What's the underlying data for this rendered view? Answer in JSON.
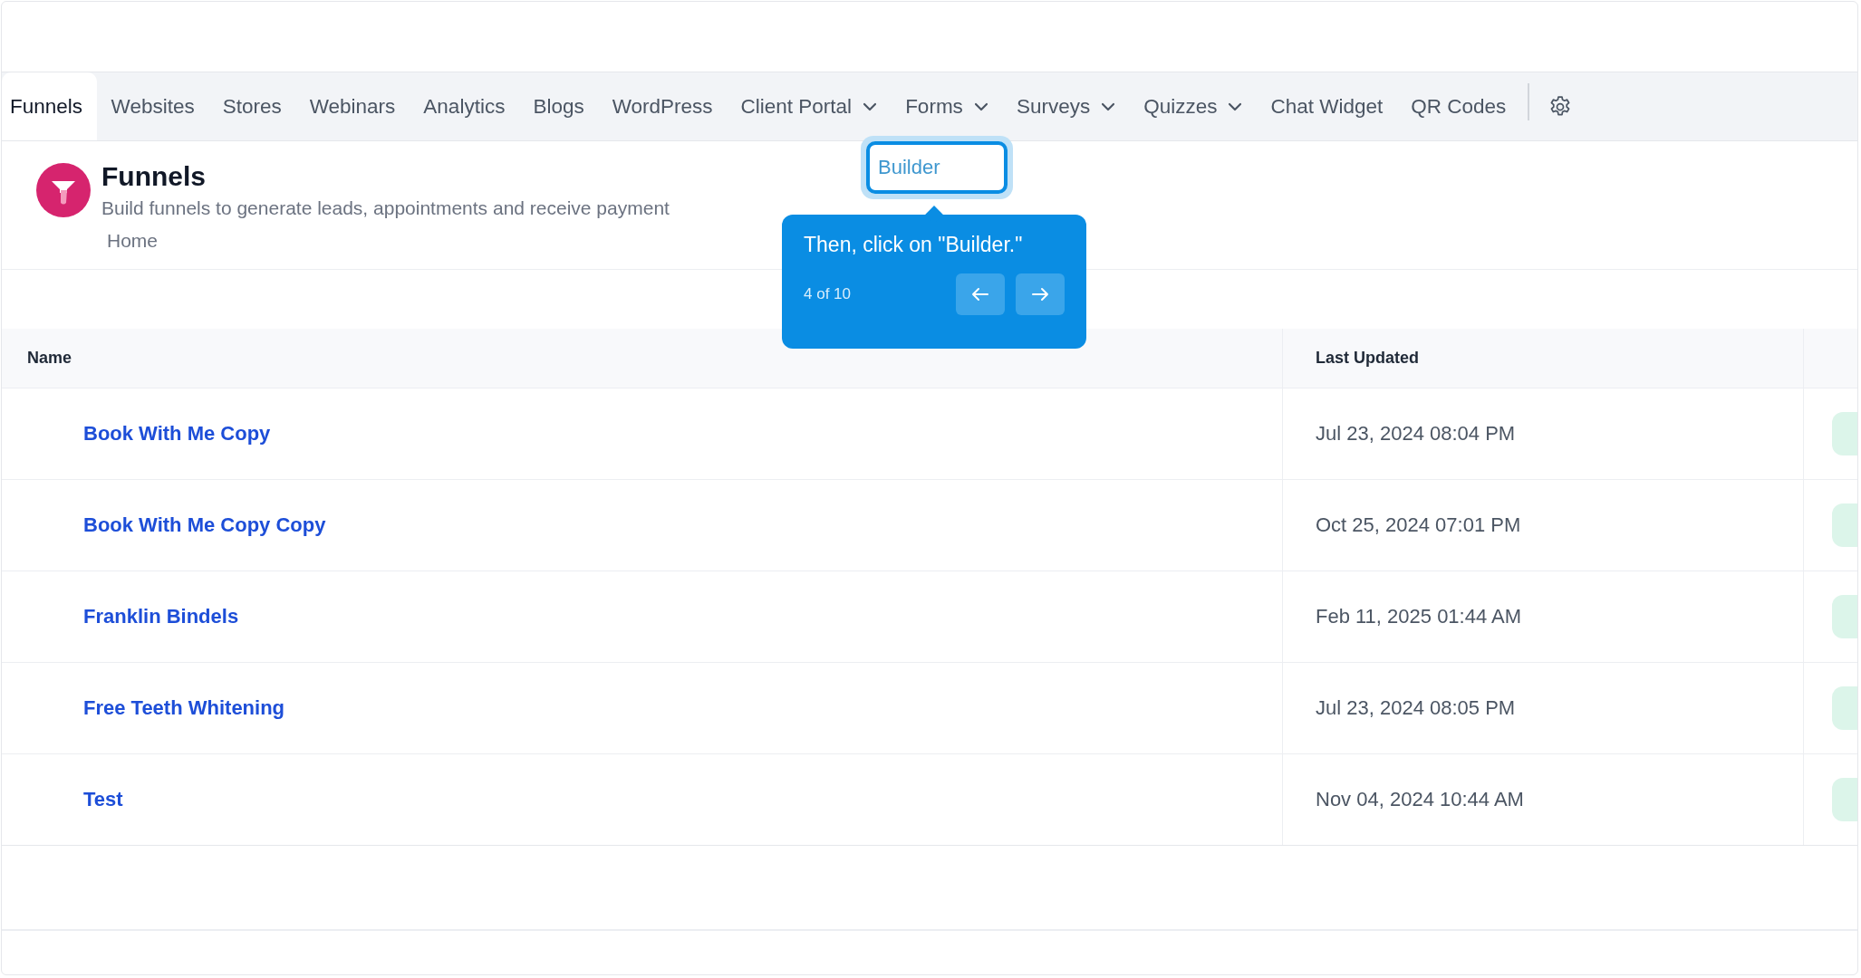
{
  "tabs": [
    {
      "label": "Funnels",
      "selected": true,
      "kind": "link"
    },
    {
      "label": "Websites",
      "selected": false,
      "kind": "link"
    },
    {
      "label": "Stores",
      "selected": false,
      "kind": "link"
    },
    {
      "label": "Webinars",
      "selected": false,
      "kind": "link"
    },
    {
      "label": "Analytics",
      "selected": false,
      "kind": "link"
    },
    {
      "label": "Blogs",
      "selected": false,
      "kind": "link"
    },
    {
      "label": "WordPress",
      "selected": false,
      "kind": "link"
    },
    {
      "label": "Client Portal",
      "selected": false,
      "kind": "dropdown"
    },
    {
      "label": "Forms",
      "selected": false,
      "kind": "dropdown"
    },
    {
      "label": "Surveys",
      "selected": false,
      "kind": "dropdown"
    },
    {
      "label": "Quizzes",
      "selected": false,
      "kind": "dropdown"
    },
    {
      "label": "Chat Widget",
      "selected": false,
      "kind": "link"
    },
    {
      "label": "QR Codes",
      "selected": false,
      "kind": "link"
    }
  ],
  "header": {
    "title": "Funnels",
    "subtitle": "Build funnels to generate leads, appointments and receive payment",
    "breadcrumb": "Home"
  },
  "highlighted_item": {
    "label": "Builder"
  },
  "tooltip": {
    "text": "Then, click on \"Builder.\"",
    "step": "4 of 10"
  },
  "table": {
    "columns": [
      "Name",
      "Last Updated"
    ],
    "rows": [
      {
        "name": "Book With Me Copy",
        "updated": "Jul 23, 2024 08:04 PM"
      },
      {
        "name": "Book With Me Copy Copy",
        "updated": "Oct 25, 2024 07:01 PM"
      },
      {
        "name": "Franklin Bindels",
        "updated": "Feb 11, 2025 01:44 AM"
      },
      {
        "name": "Free Teeth Whitening",
        "updated": "Jul 23, 2024 08:05 PM"
      },
      {
        "name": "Test",
        "updated": "Nov 04, 2024 10:44 AM"
      }
    ]
  }
}
